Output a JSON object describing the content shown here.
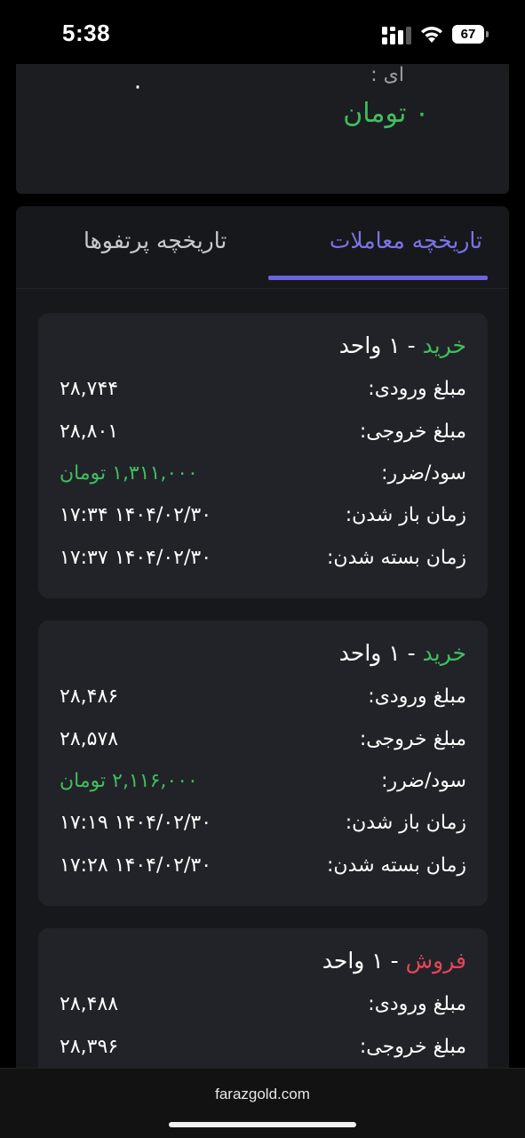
{
  "status_bar": {
    "time": "5:38",
    "battery": "67",
    "icons": [
      "signal-icon",
      "wifi-icon",
      "battery-icon"
    ]
  },
  "summary": {
    "label": "ای :",
    "amount": "۰ تومان",
    "left_value": "۰"
  },
  "tabs": [
    {
      "label": "تاریخچه معاملات",
      "active": true
    },
    {
      "label": "تاریخچه پرتفوها",
      "active": false
    }
  ],
  "field_labels": {
    "entry": "مبلغ ورودی:",
    "exit": "مبلغ خروجی:",
    "profit": "سود/ضرر:",
    "open_time": "زمان باز شدن:",
    "close_time": "زمان بسته شدن:"
  },
  "trades": [
    {
      "side": "خرید",
      "rest": " - ۱ واحد",
      "entry": "۲۸,۷۴۴",
      "exit": "۲۸,۸۰۱",
      "profit": "۱,۳۱۱,۰۰۰ تومان",
      "open_time": "۱۴۰۴/۰۲/۳۰ ۱۷:۳۴",
      "close_time": "۱۴۰۴/۰۲/۳۰ ۱۷:۳۷"
    },
    {
      "side": "خرید",
      "rest": " - ۱ واحد",
      "entry": "۲۸,۴۸۶",
      "exit": "۲۸,۵۷۸",
      "profit": "۲,۱۱۶,۰۰۰ تومان",
      "open_time": "۱۴۰۴/۰۲/۳۰ ۱۷:۱۹",
      "close_time": "۱۴۰۴/۰۲/۳۰ ۱۷:۲۸"
    },
    {
      "side": "فروش",
      "rest": " - ۱ واحد",
      "entry": "۲۸,۴۸۸",
      "exit": "۲۸,۳۹۶"
    }
  ],
  "colors": {
    "buy": "#3fbf5f",
    "sell": "#e0475a",
    "accent": "#6c63e0",
    "card": "#222328"
  },
  "browser": {
    "url": "farazgold.com"
  }
}
